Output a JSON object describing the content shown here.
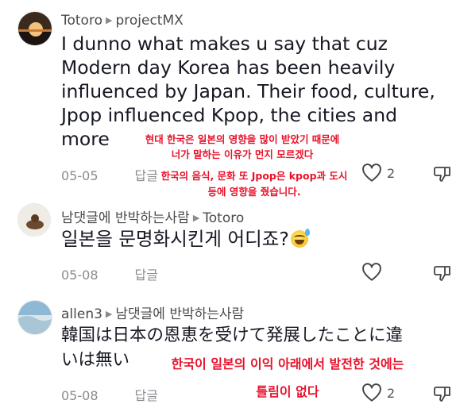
{
  "comments": [
    {
      "user": "Totoro",
      "reply_to": "projectMX",
      "text_lines": [
        "I dunno what makes u say that cuz",
        "Modern day Korea has been heavily",
        "influenced by Japan. Their food, culture,",
        "Jpop influenced Kpop, the cities and",
        "more"
      ],
      "date": "05-05",
      "reply_label": "답글",
      "likes": "2",
      "annotation_lines": [
        "현대 한국은 일본의 영향을 많이 받았기 때문에",
        "너가 말하는 이유가 먼지 모르겠다",
        "한국의 음식, 문화 또 Jpop은 kpop과 도시",
        "등에 영향을 줬습니다."
      ]
    },
    {
      "user": "남댓글에 반박하는사람",
      "reply_to": "Totoro",
      "text": "일본을 문명화시킨게 어디죠?",
      "emoji": "sweat-smile-emoji",
      "date": "05-08",
      "reply_label": "답글"
    },
    {
      "user": "allen3",
      "reply_to": "남댓글에 반박하는사람",
      "text_lines": [
        "韓国は日本の恩恵を受けて発展したことに違",
        "いは無い"
      ],
      "date": "05-08",
      "reply_label": "답글",
      "likes": "2",
      "annotation_lines": [
        "한국이 일본의 이익 아래에서 발전한 것에는",
        "틀림이 없다"
      ]
    }
  ],
  "colors": {
    "annotation": "#e8122b",
    "meta": "#8a8b91"
  }
}
